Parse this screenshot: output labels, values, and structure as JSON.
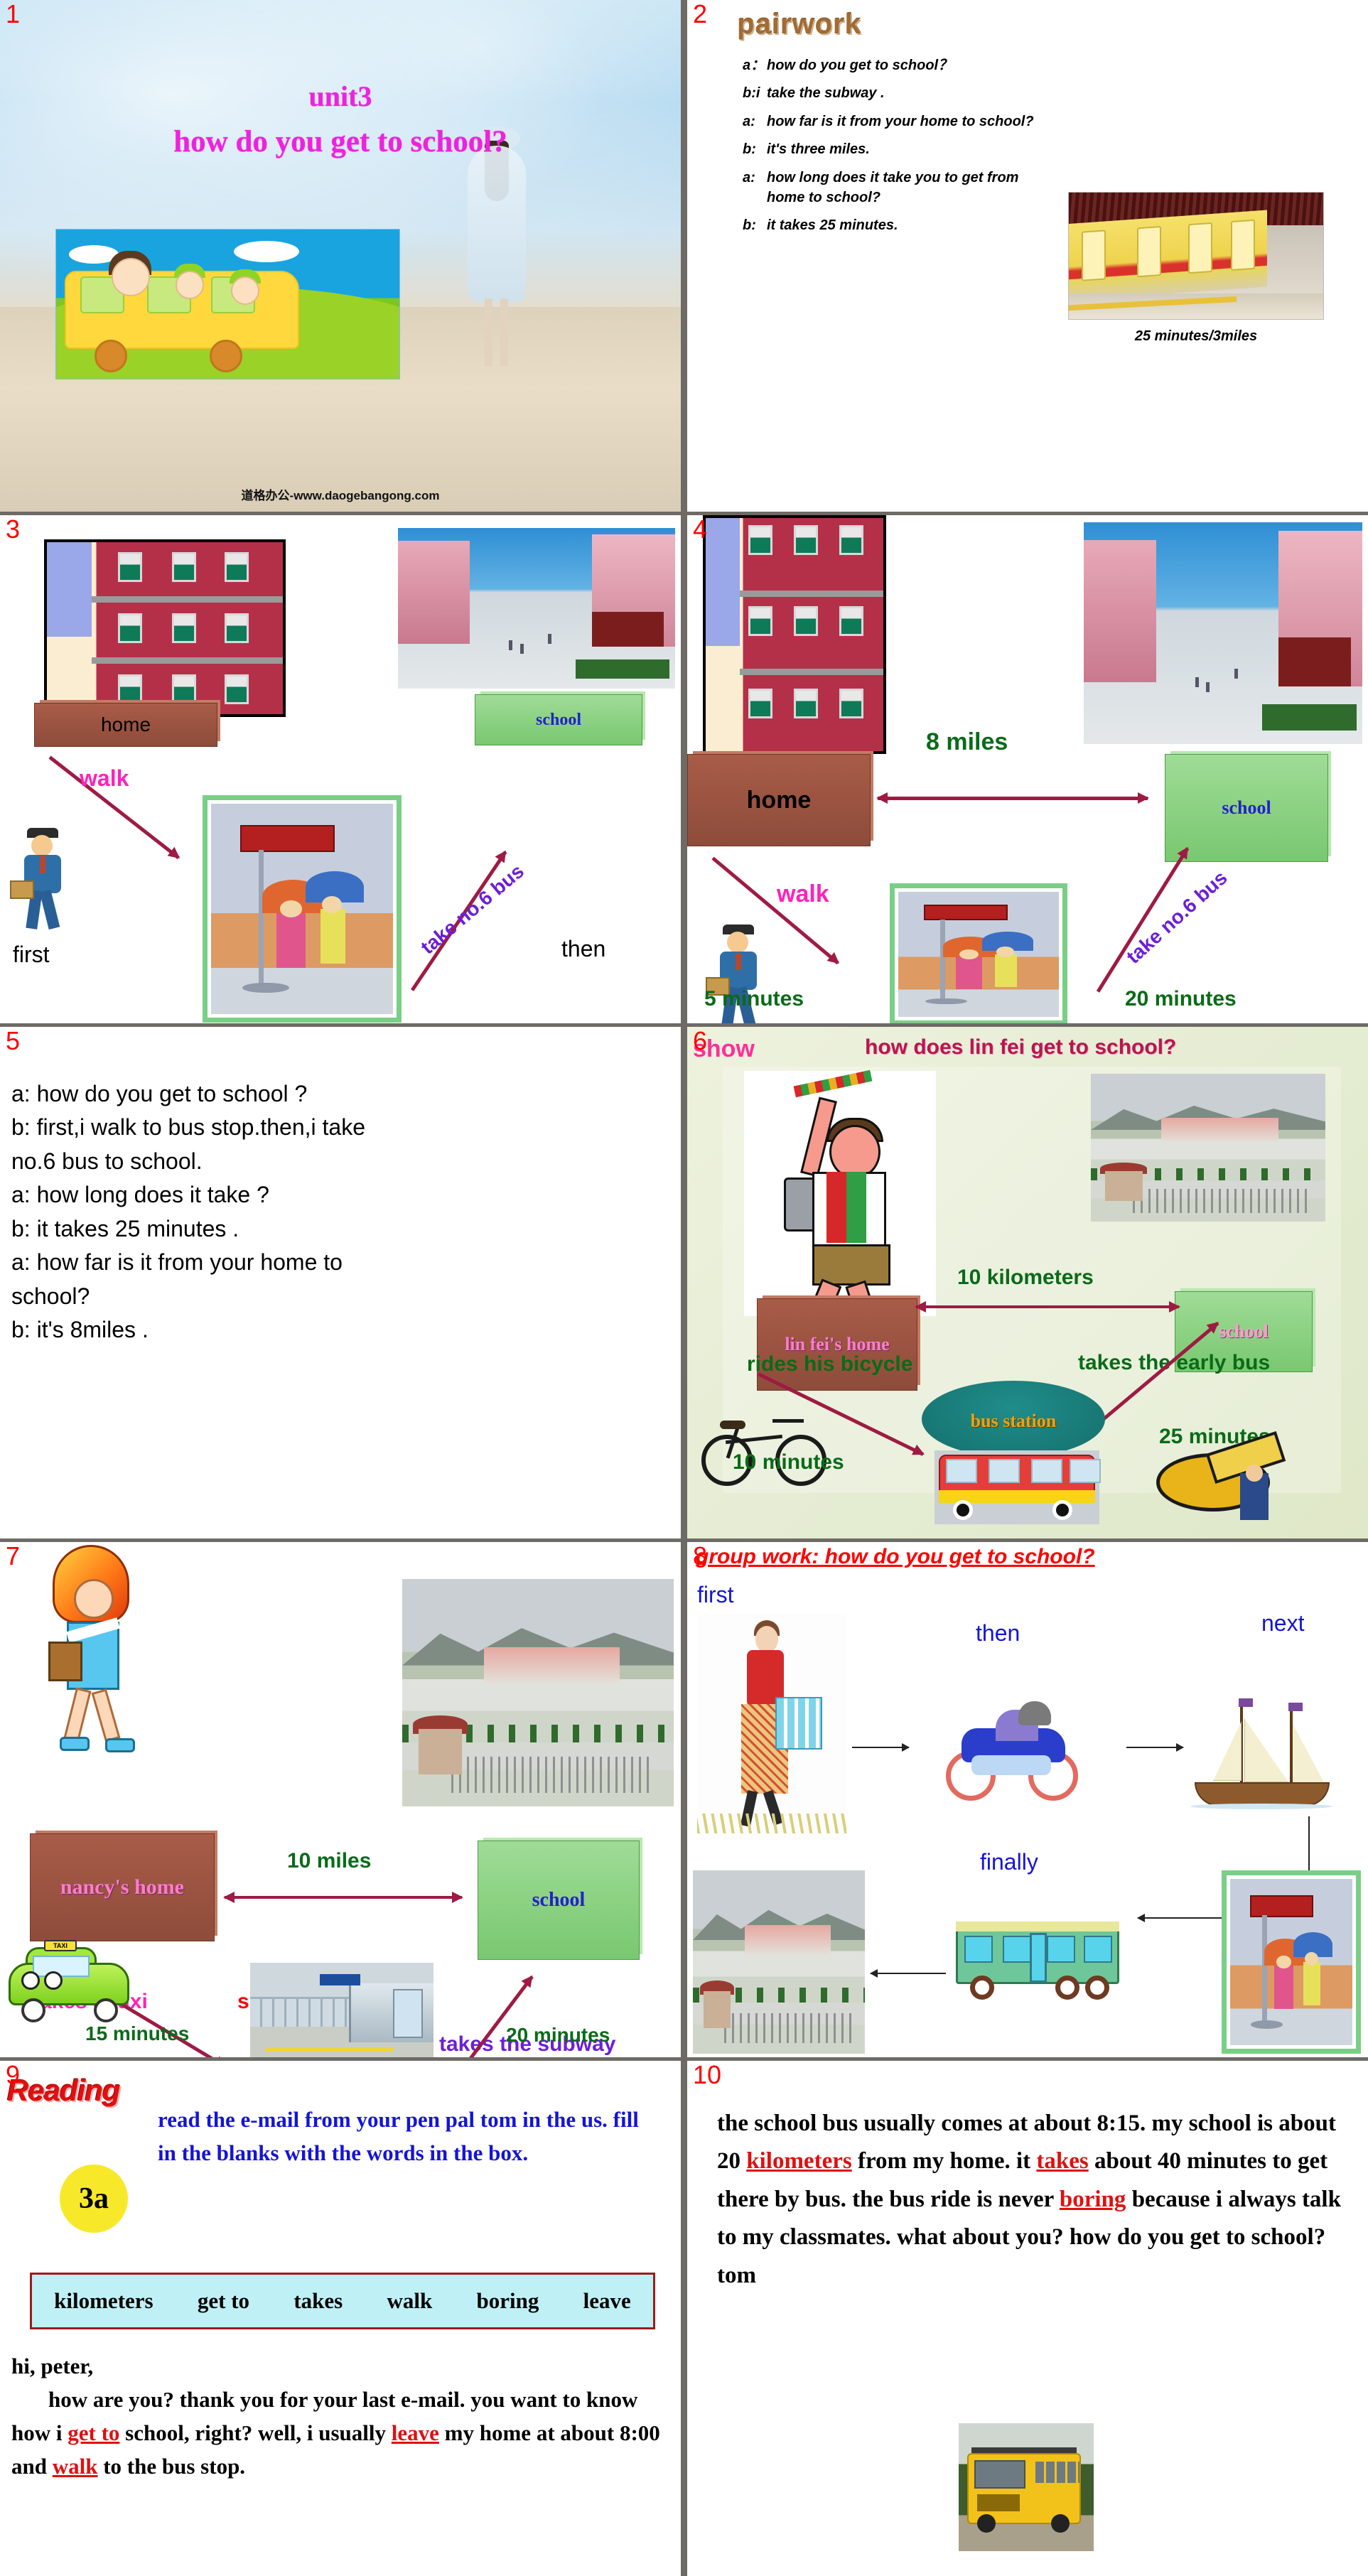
{
  "slides": [
    {
      "num": "1",
      "title_line1": "unit3",
      "title_line2": "how do you get to school?",
      "watermark": "道格办公-www.daogebangong.com"
    },
    {
      "num": "2",
      "heading": "pairwork",
      "dialogue": [
        {
          "speaker": "a：",
          "text": "how do you get to school？"
        },
        {
          "speaker": "b:i",
          "text": "take the subway ."
        },
        {
          "speaker": "a:",
          "text": "how far is it from your home to school?"
        },
        {
          "speaker": "b:",
          "text": "it's three miles."
        },
        {
          "speaker": "a:",
          "text": "how long does it take you to get from home to school?"
        },
        {
          "speaker": "b:",
          "text": "it takes 25 minutes."
        }
      ],
      "caption": "25 minutes/3miles"
    },
    {
      "num": "3",
      "home_label": "home",
      "school_label": "school",
      "walk_label": "walk",
      "bus_label": "take no.6 bus",
      "first_label": "first",
      "then_label": "then"
    },
    {
      "num": "4",
      "home_label": "home",
      "school_label": "school",
      "distance_label": "8 miles",
      "walk_label": "walk",
      "bus_label": "take no.6 bus",
      "walk_time": "5 minutes",
      "bus_time": "20 minutes"
    },
    {
      "num": "5",
      "lines": [
        "a: how do you get to school ?",
        "b: first,i walk to bus stop.then,i take",
        "no.6 bus to school.",
        "a: how long does it take ?",
        "b: it takes 25 minutes .",
        "a: how far is it from your home to",
        "school?",
        "b: it's 8miles ."
      ]
    },
    {
      "num": "6",
      "show_label": "show",
      "question": "how does lin fei get to school?",
      "home_label": "lin fei's home",
      "school_label": "school",
      "distance_label": "10 kilometers",
      "bicycle_label": "rides his bicycle",
      "bus_label": "takes the early bus",
      "station_label": "bus station",
      "bicycle_time": "10 minutes",
      "bus_time": "25 minutes"
    },
    {
      "num": "7",
      "home_label": "nancy's home",
      "school_label": "school",
      "distance_label": "10 miles",
      "taxi_label": "takes a taxi",
      "station_label": "subway station",
      "subway_label": "takes the subway",
      "taxi_time": "15 minutes",
      "subway_time": "20 minutes"
    },
    {
      "num": "8",
      "heading": "group work: how do you get to school?",
      "step_first": "first",
      "step_then": "then",
      "step_next": "next",
      "step_finally": "finally"
    },
    {
      "num": "9",
      "reading_label": "Reading",
      "badge": "3a",
      "instruction": "read the e-mail from your pen pal tom in the us. fill in the blanks with the words in the box.",
      "word_box": [
        "kilometers",
        "get to",
        "takes",
        "walk",
        "boring",
        "leave"
      ],
      "greeting": "hi, peter,",
      "para_a": "how are you? thank you for your last e-mail. you want to know how i",
      "blank1": "get to",
      "para_b": "school, right? well, i usually",
      "blank2": "leave",
      "para_c": "my home at about 8:00 and",
      "blank3": "walk",
      "para_d": "to the bus stop."
    },
    {
      "num": "10",
      "para_a": "the school bus usually comes at about 8:15. my school is about 20",
      "blank1": "kilometers",
      "para_b": "from my home. it",
      "blank2": "takes",
      "para_c": "about 40 minutes to get there by bus. the bus ride is never",
      "blank3": "boring",
      "para_d": "because i always talk to my classmates. what about you? how do you get to school?",
      "signature": "tom"
    }
  ],
  "colors": {
    "slide_number": "#ff0000",
    "title_magenta": "#ee22dd",
    "arrow_maroon": "#9e1b43",
    "green_text": "#0a6b18",
    "blue_text": "#1414d8",
    "purple_text": "#6b1fd8",
    "pink_text": "#ff2e9a",
    "blank_red": "#e01010",
    "separator_gray": "#6e6a66"
  }
}
